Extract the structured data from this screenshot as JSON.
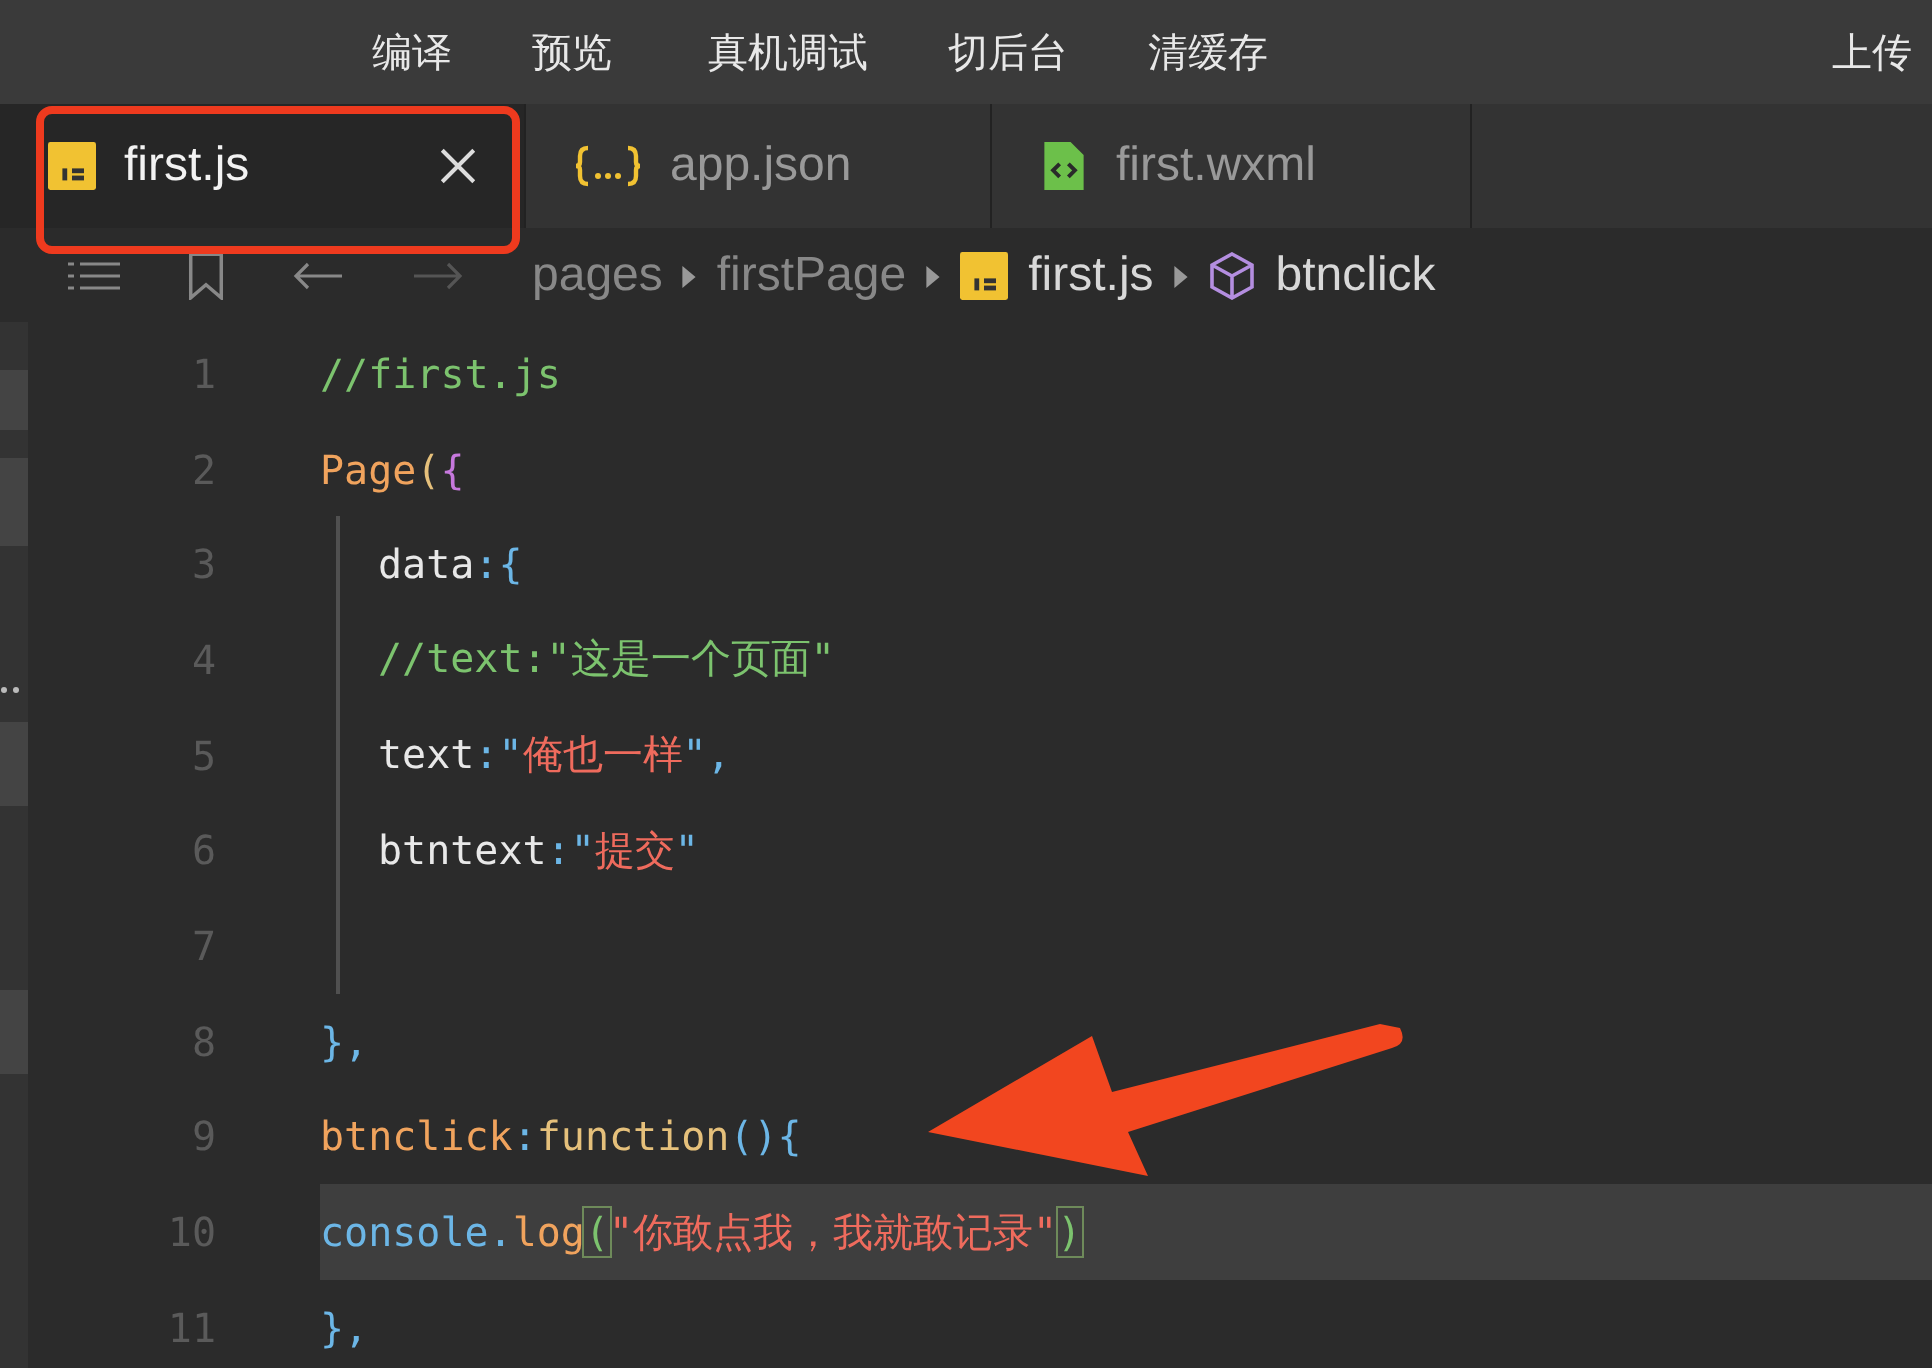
{
  "toolbar": {
    "items": [
      {
        "label": "编译"
      },
      {
        "label": "预览"
      },
      {
        "label": "真机调试"
      },
      {
        "label": "切后台"
      },
      {
        "label": "清缓存"
      },
      {
        "label": "上传"
      }
    ]
  },
  "tabs": [
    {
      "label": "first.js",
      "kind": "js",
      "selected": true,
      "closable": true
    },
    {
      "label": "app.json",
      "kind": "json",
      "selected": false,
      "closable": false
    },
    {
      "label": "first.wxml",
      "kind": "wxml",
      "selected": false,
      "closable": false
    }
  ],
  "breadcrumb": [
    {
      "label": "pages",
      "kind": "folder"
    },
    {
      "label": "firstPage",
      "kind": "folder"
    },
    {
      "label": "first.js",
      "kind": "js"
    },
    {
      "label": "btnclick",
      "kind": "symbol"
    }
  ],
  "code": {
    "lines": [
      {
        "number": "1",
        "indented": false,
        "current": false,
        "tokens": [
          {
            "text": "//first.js",
            "kind": "comment"
          }
        ]
      },
      {
        "number": "2",
        "indented": false,
        "current": false,
        "tokens": [
          {
            "text": "Page",
            "kind": "func"
          },
          {
            "text": "(",
            "kind": "paren"
          },
          {
            "text": "{",
            "kind": "brace"
          }
        ]
      },
      {
        "number": "3",
        "indented": true,
        "current": false,
        "tokens": [
          {
            "text": "data",
            "kind": "prop"
          },
          {
            "text": ":{",
            "kind": "punct"
          }
        ]
      },
      {
        "number": "4",
        "indented": true,
        "current": false,
        "tokens": [
          {
            "text": "//text:\"这是一个页面\"",
            "kind": "comment"
          }
        ]
      },
      {
        "number": "5",
        "indented": true,
        "current": false,
        "tokens": [
          {
            "text": "text",
            "kind": "prop"
          },
          {
            "text": ":\"",
            "kind": "punct"
          },
          {
            "text": "俺也一样",
            "kind": "string"
          },
          {
            "text": "\",",
            "kind": "punct"
          }
        ]
      },
      {
        "number": "6",
        "indented": true,
        "current": false,
        "tokens": [
          {
            "text": "btntext",
            "kind": "prop"
          },
          {
            "text": ":\"",
            "kind": "punct"
          },
          {
            "text": "提交",
            "kind": "string"
          },
          {
            "text": "\"",
            "kind": "punct"
          }
        ]
      },
      {
        "number": "7",
        "indented": true,
        "current": false
      },
      {
        "number": "8",
        "indented": false,
        "current": false,
        "tokens": [
          {
            "text": "},",
            "kind": "punct"
          }
        ]
      },
      {
        "number": "9",
        "indented": false,
        "current": false,
        "tokens": [
          {
            "text": "btnclick",
            "kind": "func"
          },
          {
            "text": ":",
            "kind": "punct"
          },
          {
            "text": "function",
            "kind": "keyword"
          },
          {
            "text": "(){",
            "kind": "punct"
          }
        ]
      },
      {
        "number": "10",
        "indented": false,
        "current": true,
        "tokens": [
          {
            "text": "console.",
            "kind": "punct"
          },
          {
            "text": "log",
            "kind": "func"
          },
          {
            "text": "(",
            "kind": "matched"
          },
          {
            "text": "\"你敢点我，我就敢记录\"",
            "kind": "string"
          },
          {
            "text": ")",
            "kind": "matched"
          }
        ]
      },
      {
        "number": "11",
        "indented": false,
        "current": false,
        "tokens": [
          {
            "text": "},",
            "kind": "punct"
          }
        ]
      }
    ]
  }
}
